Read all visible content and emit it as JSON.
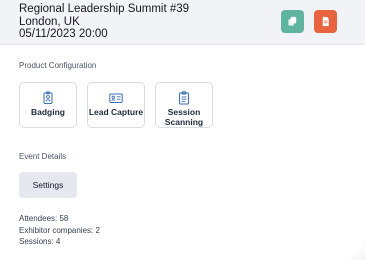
{
  "event": {
    "title": "Regional Leadership Summit #39",
    "location": "London, UK",
    "datetime": "05/11/2023 20:00"
  },
  "header_actions": {
    "copy_icon": "copy-icon",
    "document_icon": "document-icon",
    "copy_color": "#5fb4a0",
    "document_color": "#e8633f"
  },
  "product_configuration": {
    "label": "Product Configuration",
    "cards": [
      {
        "label": "Badging",
        "icon": "badge-icon"
      },
      {
        "label": "Lead Capture",
        "icon": "id-card-icon"
      },
      {
        "label": "Session Scanning",
        "icon": "clipboard-icon"
      }
    ]
  },
  "event_details": {
    "label": "Event Details",
    "settings_label": "Settings"
  },
  "stats": {
    "attendees": "Attendees: 58",
    "exhibitors": "Exhibitor companies: 2",
    "sessions": "Sessions: 4"
  }
}
